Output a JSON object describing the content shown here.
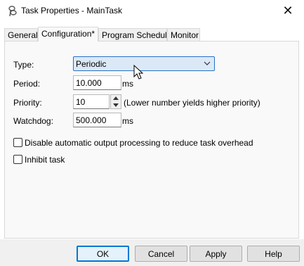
{
  "window": {
    "title": "Task Properties - MainTask",
    "close_glyph": "✕"
  },
  "tabs": [
    {
      "label": "General"
    },
    {
      "label": "Configuration*"
    },
    {
      "label": "Program Schedule"
    },
    {
      "label": "Monitor"
    }
  ],
  "form": {
    "type_label": "Type:",
    "type_value": "Periodic",
    "period_label": "Period:",
    "period_value": "10.000",
    "period_unit": "ms",
    "priority_label": "Priority:",
    "priority_value": "10",
    "priority_hint": "(Lower number yields higher priority)",
    "watchdog_label": "Watchdog:",
    "watchdog_value": "500.000",
    "watchdog_unit": "ms",
    "disable_output_label": "Disable automatic output processing to reduce task overhead",
    "inhibit_label": "Inhibit task"
  },
  "buttons": {
    "ok": "OK",
    "cancel": "Cancel",
    "apply": "Apply",
    "help": "Help"
  }
}
